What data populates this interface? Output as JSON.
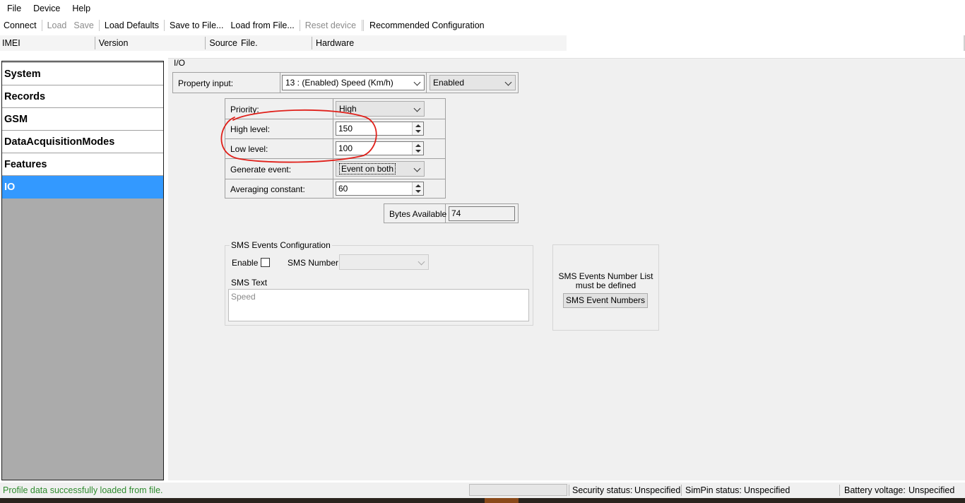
{
  "menu": [
    "File",
    "Device",
    "Help"
  ],
  "toolbar": {
    "connect": "Connect",
    "load": "Load",
    "save": "Save",
    "load_defaults": "Load Defaults",
    "save_to_file": "Save to File...",
    "load_from_file": "Load from File...",
    "reset_device": "Reset device",
    "recommended": "Recommended Configuration"
  },
  "infobar": {
    "imei_label": "IMEI",
    "version_label": "Version",
    "source_label": "Source",
    "source_value": "File.",
    "hardware_label": "Hardware"
  },
  "sidebar": {
    "items": [
      "System",
      "Records",
      "GSM",
      "DataAcquisitionModes",
      "Features",
      "IO"
    ],
    "active": "IO"
  },
  "io": {
    "title": "I/O",
    "property_input_label": "Property input:",
    "property_input_value": "13 : (Enabled) Speed (Km/h)",
    "enabled_value": "Enabled",
    "priority_label": "Priority:",
    "priority_value": "High",
    "high_level_label": "High level:",
    "high_level_value": "150",
    "low_level_label": "Low level:",
    "low_level_value": "100",
    "generate_event_label": "Generate event:",
    "generate_event_value": "Event on both",
    "averaging_label": "Averaging constant:",
    "averaging_value": "60",
    "bytes_available_label": "Bytes Available",
    "bytes_available_value": "74"
  },
  "sms": {
    "group_title": "SMS Events Configuration",
    "enable_label": "Enable",
    "enable_checked": false,
    "sms_number_label": "SMS Number",
    "sms_number_value": "",
    "sms_text_label": "SMS Text",
    "sms_text_placeholder": "Speed",
    "numbers_notice_line1": "SMS Events Number List",
    "numbers_notice_line2": "must be defined",
    "numbers_button": "SMS Event Numbers"
  },
  "status": {
    "message": "Profile data successfully loaded from file.",
    "message_color": "#2e8b2e",
    "security_label": "Security status:",
    "security_value": "Unspecified",
    "simpin_label": "SimPin status:",
    "simpin_value": "Unspecified",
    "battery_label": "Battery voltage:",
    "battery_value": "Unspecified"
  },
  "colors": {
    "accent": "#3399ff",
    "annotation": "#e0201a"
  }
}
